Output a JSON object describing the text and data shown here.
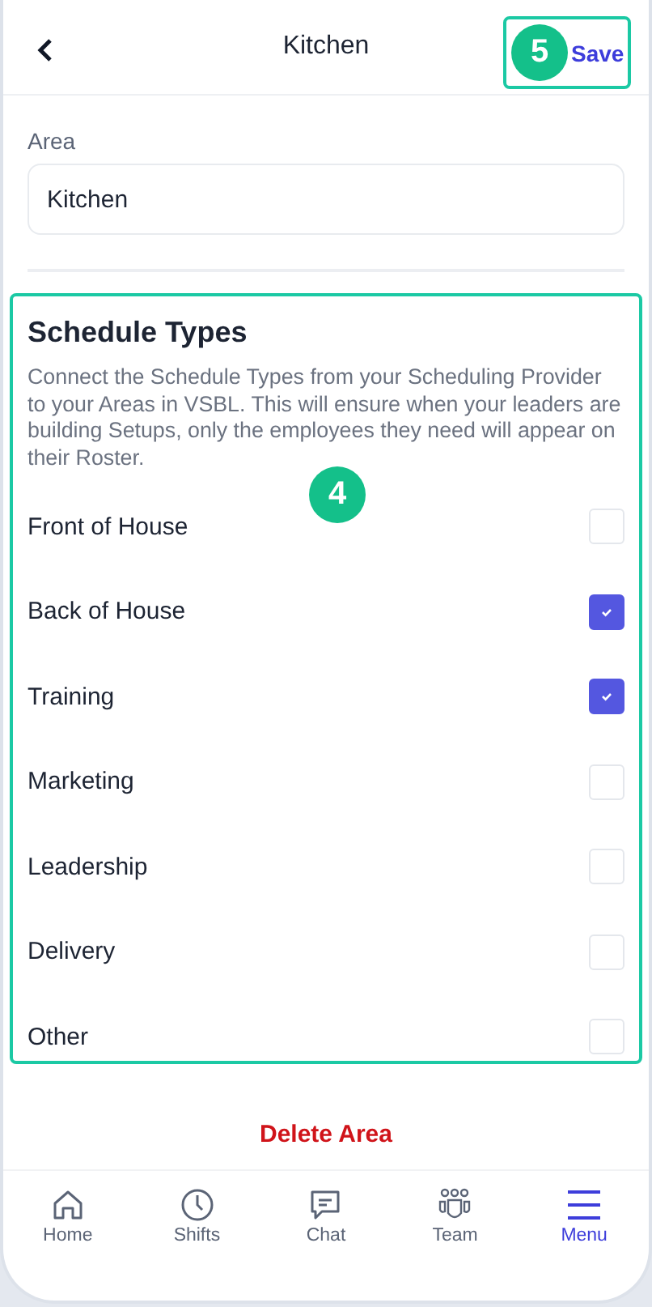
{
  "header": {
    "title": "Kitchen",
    "save": "Save",
    "callout": "5"
  },
  "area": {
    "label": "Area",
    "value": "Kitchen"
  },
  "schedule_types": {
    "title": "Schedule Types",
    "description": "Connect the Schedule Types from your Scheduling Provider to your Areas in VSBL. This will ensure when your leaders are building Setups, only the employees they need will appear on their Roster.",
    "callout": "4",
    "items": [
      {
        "label": "Front of House",
        "checked": false
      },
      {
        "label": "Back of House",
        "checked": true
      },
      {
        "label": "Training",
        "checked": true
      },
      {
        "label": "Marketing",
        "checked": false
      },
      {
        "label": "Leadership",
        "checked": false
      },
      {
        "label": "Delivery",
        "checked": false
      },
      {
        "label": "Other",
        "checked": false
      }
    ]
  },
  "delete_button": "Delete Area",
  "tab_bar": [
    {
      "label": "Home",
      "kind": "home",
      "selected": false
    },
    {
      "label": "Shifts",
      "kind": "clock",
      "selected": false
    },
    {
      "label": "Chat",
      "kind": "chat",
      "selected": false
    },
    {
      "label": "Team",
      "kind": "team",
      "selected": false
    },
    {
      "label": "Menu",
      "kind": "menu",
      "selected": true
    }
  ]
}
